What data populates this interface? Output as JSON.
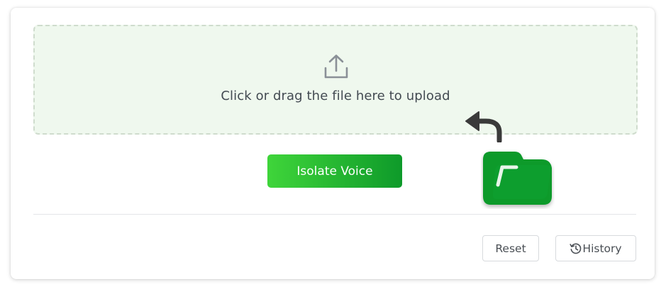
{
  "upload": {
    "icon": "upload-icon",
    "prompt": "Click or drag the file here to upload"
  },
  "actions": {
    "isolate_label": "Isolate Voice",
    "reset_label": "Reset",
    "history_label": "History"
  },
  "icons": {
    "hint": "curved-arrow-icon",
    "folder": "folder-icon",
    "history": "history-icon"
  },
  "colors": {
    "dropzone_bg": "#eff8ee",
    "accent_start": "#3fd53a",
    "accent_end": "#0e9a2a",
    "folder": "#0a9a2c",
    "arrow": "#3a3a3a"
  }
}
